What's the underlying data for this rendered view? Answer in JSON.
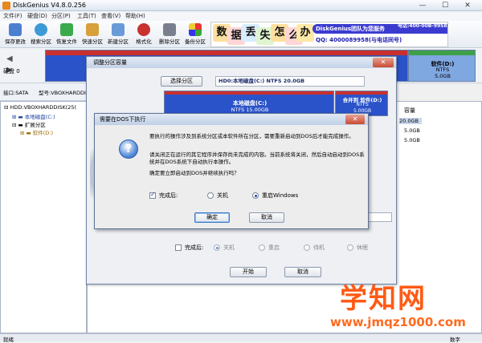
{
  "window": {
    "title": "DiskGenius V4.8.0.256"
  },
  "menus": [
    "文件(F)",
    "硬盘(D)",
    "分区(P)",
    "工具(T)",
    "查看(V)",
    "帮助(H)"
  ],
  "toolbar": [
    "保存更改",
    "搜索分区",
    "恢复文件",
    "快速分区",
    "新建分区",
    "格式化",
    "删除分区",
    "备份分区"
  ],
  "ad": {
    "chars": [
      "数",
      "据",
      "丢",
      "失",
      "怎",
      "么",
      "办"
    ],
    "bar": "DiskGenius团队为您服务",
    "qq": "QQ: 4000089958(与电话同号)",
    "tel": "电话:400-00B-9958"
  },
  "left": {
    "disk_label": "硬盘 0",
    "iface": "接口:SATA",
    "model": "型号:VBOXHARDDISK"
  },
  "strip": {
    "part_name": "软件(D:)",
    "fs": "NTFS",
    "size": "5.0GB"
  },
  "tree": {
    "disk": "HDD:VBOXHARDDISK(25(",
    "items": [
      "本地磁盘(C:)",
      "扩展分区",
      "软件(D:)"
    ]
  },
  "list": {
    "header": "容量",
    "values": [
      "20.0GB",
      "5.0GB",
      "5.0GB"
    ]
  },
  "resize": {
    "title": "调整分区容量",
    "select_btn": "选择分区",
    "info": "HD0:本地磁盘(C:) NTFS 20.0GB",
    "part1": {
      "name": "本地磁盘(C:)",
      "detail": "NTFS 15.00GB"
    },
    "part2": {
      "name": "合并到 软件(D:)",
      "fs": "NTFS",
      "size": "5.00GB"
    },
    "after_label": "完成后:",
    "opts": [
      "关机",
      "重启",
      "待机",
      "休眠"
    ],
    "start": "开始",
    "cancel": "取消"
  },
  "dos": {
    "title": "需要在DOS下执行",
    "m1": "要执行的操作涉及到系统分区或本软件所在分区，需要重新启动到DOS后才能完成操作。",
    "m2": "请关闭正在运行的其它程序并保存尚未完成的内容。当前系统将关闭，然后自动启动到DOS系统并在DOS系统下自动执行本操作。",
    "m3": "确定要立即启动到DOS并继续执行吗？",
    "after": "完成后:",
    "opt_shutdown": "关机",
    "opt_reboot": "重启Windows",
    "ok": "确定",
    "cancel": "取消"
  },
  "status": {
    "left": "就绪",
    "right": "数字"
  },
  "watermark": {
    "big": "学知网",
    "url": "www.jmqz1000.com"
  },
  "colors": {
    "accent": "#1d4fa0",
    "partition_blue": "#2a52c9",
    "partition_header": "#c8302e",
    "watermark": "#ff5a14"
  }
}
